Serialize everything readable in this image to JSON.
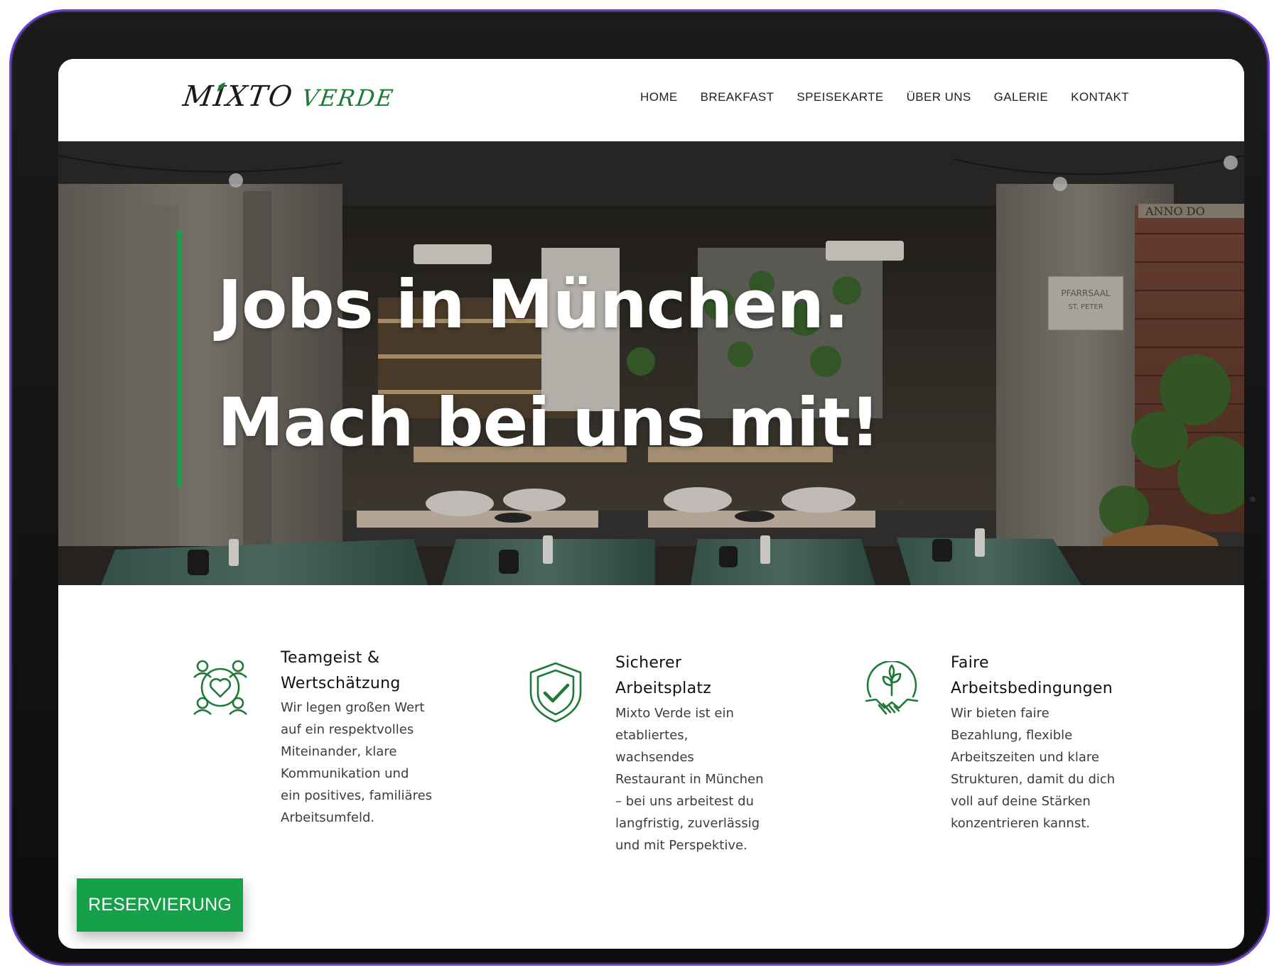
{
  "header": {
    "logo_part1": "MIXTO",
    "logo_part2": "VERDE",
    "nav": [
      {
        "label": "HOME"
      },
      {
        "label": "BREAKFAST"
      },
      {
        "label": "SPEISEKARTE"
      },
      {
        "label": "ÜBER UNS"
      },
      {
        "label": "GALERIE"
      },
      {
        "label": "KONTAKT"
      }
    ]
  },
  "hero": {
    "title_line1": "Jobs in München.",
    "title_line2": "Mach bei uns mit!",
    "sign_text_1": "PFARRSAAL",
    "sign_text_2": "ST. PETER",
    "sign_top": "ANNO DO"
  },
  "features": [
    {
      "icon": "team-heart-icon",
      "title_line1": "Teamgeist &",
      "title_line2": "Wertschätzung",
      "text": [
        "Wir legen großen Wert",
        "auf ein respektvolles",
        "Miteinander, klare",
        "Kommunikation und",
        "ein positives, familiäres",
        "Arbeitsumfeld."
      ]
    },
    {
      "icon": "shield-check-icon",
      "title_line1": "Sicherer",
      "title_line2": "Arbeitsplatz",
      "text": [
        "Mixto Verde ist ein",
        "etabliertes,",
        "wachsendes",
        "Restaurant in München",
        "– bei uns arbeitest du",
        "langfristig, zuverlässig",
        "und mit Perspektive."
      ]
    },
    {
      "icon": "handshake-plant-icon",
      "title_line1": "Faire",
      "title_line2": "Arbeitsbedingungen",
      "text": [
        "Wir bieten faire",
        "Bezahlung, flexible",
        "Arbeitszeiten und klare",
        "Strukturen, damit du dich",
        "voll auf deine Stärken",
        "konzentrieren kannst."
      ]
    }
  ],
  "reserve_button": "RESERVIERUNG",
  "colors": {
    "brand_green": "#15a049",
    "icon_green": "#1f7a3a",
    "device_frame": "#111113",
    "device_outline": "#6e3fd6"
  }
}
